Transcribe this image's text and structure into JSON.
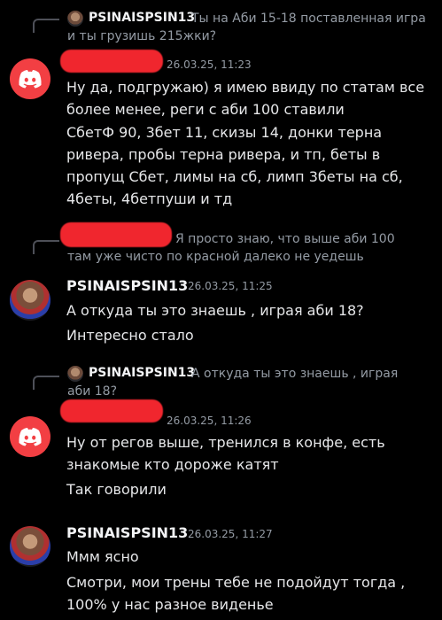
{
  "colors": {
    "background": "#000000",
    "discord_red": "#f23f43",
    "redaction": "#f0262e",
    "muted": "#949ba4"
  },
  "groups": [
    {
      "reply": {
        "name": "PSINAISPSIN13",
        "text": "Ты на Аби 15-18 поставленная игра и ты грузишь 215жки?"
      },
      "timestamp": "26.03.25, 11:23",
      "messages": [
        "Ну да, подгружаю) я имею ввиду по статам все более менее, реги с аби 100 ставили",
        "СбетФ 90, 3бет 11, скизы 14, донки терна ривера, пробы терна ривера, и тп, беты в пропущ Сбет, лимы на сб, лимп 3беты на сб, 4беты, 4бетпуши и тд"
      ]
    },
    {
      "reply": {
        "text": "Я просто знаю, что выше аби 100 там уже чисто по красной далеко не уедешь"
      },
      "name": "PSINAISPSIN13",
      "timestamp": "26.03.25, 11:25",
      "messages": [
        "А откуда ты это знаешь , играя аби 18?",
        "Интересно стало"
      ]
    },
    {
      "reply": {
        "name": "PSINAISPSIN13",
        "text": "А откуда ты это знаешь , играя аби 18?"
      },
      "timestamp": "26.03.25, 11:26",
      "messages": [
        "Ну от регов выше, тренился в конфе, есть знакомые кто дороже катят",
        "Так говорили"
      ]
    },
    {
      "name": "PSINAISPSIN13",
      "timestamp": "26.03.25, 11:27",
      "messages": [
        "Ммм ясно",
        "Смотри, мои трены тебе не подойдут тогда , 100% у нас разное виденье"
      ]
    }
  ]
}
